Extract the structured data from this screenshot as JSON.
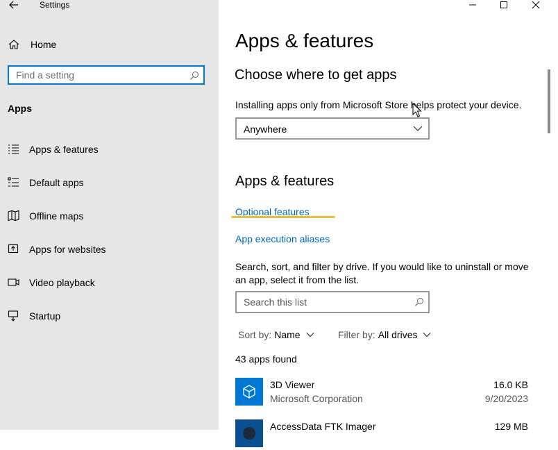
{
  "window": {
    "title": "Settings"
  },
  "sidebar": {
    "home_label": "Home",
    "search_placeholder": "Find a setting",
    "section_label": "Apps",
    "items": [
      {
        "label": "Apps & features",
        "icon": "apps-features-icon"
      },
      {
        "label": "Default apps",
        "icon": "default-apps-icon"
      },
      {
        "label": "Offline maps",
        "icon": "map-icon"
      },
      {
        "label": "Apps for websites",
        "icon": "open-in-app-icon"
      },
      {
        "label": "Video playback",
        "icon": "video-icon"
      },
      {
        "label": "Startup",
        "icon": "startup-icon"
      }
    ]
  },
  "main": {
    "title": "Apps & features",
    "choose_heading": "Choose where to get apps",
    "choose_info": "Installing apps only from Microsoft Store helps protect your device.",
    "choose_dropdown_value": "Anywhere",
    "apps_heading": "Apps & features",
    "link_optional": "Optional features",
    "link_aliases": "App execution aliases",
    "description": "Search, sort, and filter by drive. If you would like to uninstall or move an app, select it from the list.",
    "list_search_placeholder": "Search this list",
    "sort_label": "Sort by:",
    "sort_value": "Name",
    "filter_label": "Filter by:",
    "filter_value": "All drives",
    "count_text": "43 apps found",
    "apps": [
      {
        "name": "3D Viewer",
        "publisher": "Microsoft Corporation",
        "size": "16.0 KB",
        "date": "9/20/2023"
      },
      {
        "name": "AccessData FTK Imager",
        "publisher": "",
        "size": "129 MB",
        "date": ""
      }
    ]
  },
  "colors": {
    "accent": "#0078d7",
    "link": "#0067b8",
    "sidebar_bg": "#e6e6e6",
    "highlight": "#e8c234"
  }
}
